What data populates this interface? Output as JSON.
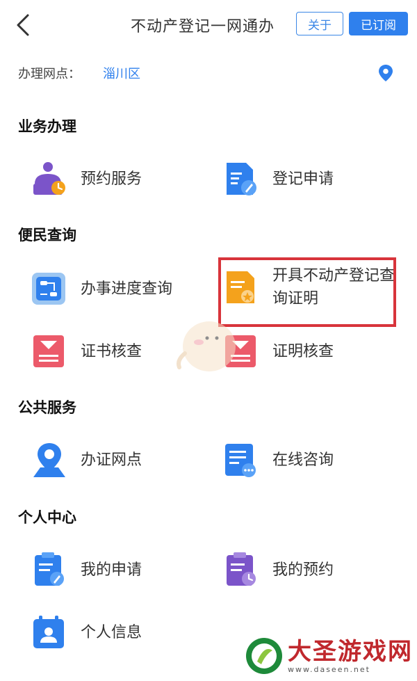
{
  "header": {
    "title": "不动产登记一网通办",
    "about_label": "关于",
    "subscribed_label": "已订阅"
  },
  "location": {
    "label": "办理网点：",
    "value": "淄川区"
  },
  "sections": {
    "business": {
      "title": "业务办理",
      "items": [
        {
          "label": "预约服务"
        },
        {
          "label": "登记申请"
        }
      ]
    },
    "convenience": {
      "title": "便民查询",
      "items": [
        {
          "label": "办事进度查询"
        },
        {
          "label": "开具不动产登记查询证明"
        },
        {
          "label": "证书核查"
        },
        {
          "label": "证明核查"
        }
      ]
    },
    "public": {
      "title": "公共服务",
      "items": [
        {
          "label": "办证网点"
        },
        {
          "label": "在线咨询"
        }
      ]
    },
    "personal": {
      "title": "个人中心",
      "items": [
        {
          "label": "我的申请"
        },
        {
          "label": "我的预约"
        },
        {
          "label": "个人信息"
        }
      ]
    }
  },
  "watermark": {
    "name": "大圣游戏网",
    "url": "www.daseen.net"
  },
  "colors": {
    "accent": "#2f80ed",
    "highlight": "#d8343b",
    "purple": "#7b54c9",
    "orange": "#f4a21c",
    "pink": "#ec5a6a"
  }
}
